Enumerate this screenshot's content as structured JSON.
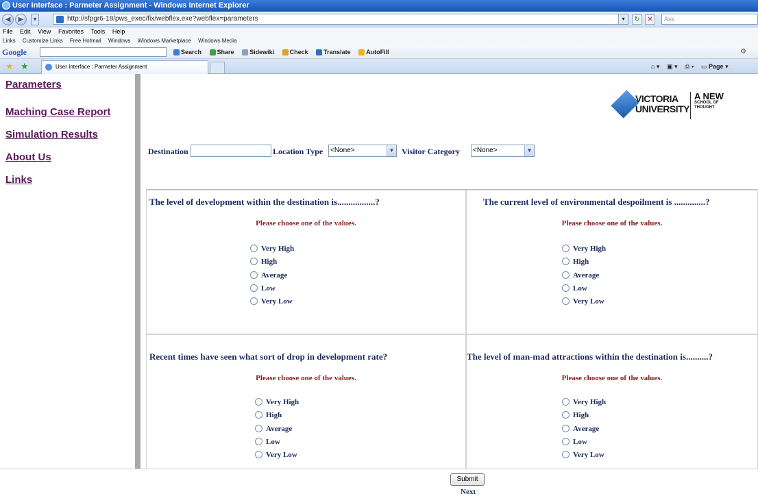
{
  "window": {
    "title": "User Interface : Parmeter Assignment - Windows Internet Explorer"
  },
  "address": {
    "url": "http://sfpgr6-18/pws_exec/fix/webflex.exe?webflex=parameters",
    "search_placeholder": "Ask"
  },
  "menu": [
    "File",
    "Edit",
    "View",
    "Favorites",
    "Tools",
    "Help"
  ],
  "links_bar": {
    "label": "Links",
    "items": [
      "Customize Links",
      "Free Hotmail",
      "Windows",
      "Windows Marketplace",
      "Windows Media"
    ]
  },
  "google_bar": {
    "logo": "Google",
    "tools": [
      "Search",
      "Share",
      "Sidewiki",
      "Check",
      "Translate",
      "AutoFill"
    ]
  },
  "tab": {
    "title": "User Interface : Parmeter Assignment"
  },
  "command_bar": {
    "page_label": "Page"
  },
  "sidebar": {
    "items": [
      "Parameters",
      "Maching Case Report",
      "Simulation Results",
      "About Us",
      "Links"
    ]
  },
  "logo": {
    "line1": "VICTORIA",
    "line2": "UNIVERSITY",
    "tag1": "A NEW",
    "tag2": "SCHOOL OF",
    "tag3": "THOUGHT"
  },
  "filters": {
    "destination_label": "Destination",
    "destination_value": "",
    "location_type_label": "Location Type",
    "location_type_value": "<None>",
    "visitor_category_label": "Visitor Category",
    "visitor_category_value": "<None>"
  },
  "questions": [
    {
      "text": "The level of development within the destination is.................?",
      "instruction": "Please choose one of the values.",
      "options": [
        "Very High",
        "High",
        "Average",
        "Low",
        "Very Low"
      ]
    },
    {
      "text": "The current level of environmental despoilment is ..............?",
      "instruction": "Please choose one of the values.",
      "options": [
        "Very High",
        "High",
        "Average",
        "Low",
        "Very Low"
      ]
    },
    {
      "text": "Recent times have seen what sort of drop in development rate?",
      "instruction": "Please choose one of the values.",
      "options": [
        "Very High",
        "High",
        "Average",
        "Low",
        "Very Low"
      ]
    },
    {
      "text": "The level of man-mad attractions within the destination is..........?",
      "instruction": "Please choose one of the values.",
      "options": [
        "Very High",
        "High",
        "Average",
        "Low",
        "Very Low"
      ]
    }
  ],
  "actions": {
    "submit": "Submit",
    "next": "Next"
  },
  "colors": {
    "sidebar_link": "#5a1a5a",
    "question_text": "#1a2a5a",
    "instruction_text": "#8b1a1a",
    "titlebar": "#1a54b8"
  }
}
